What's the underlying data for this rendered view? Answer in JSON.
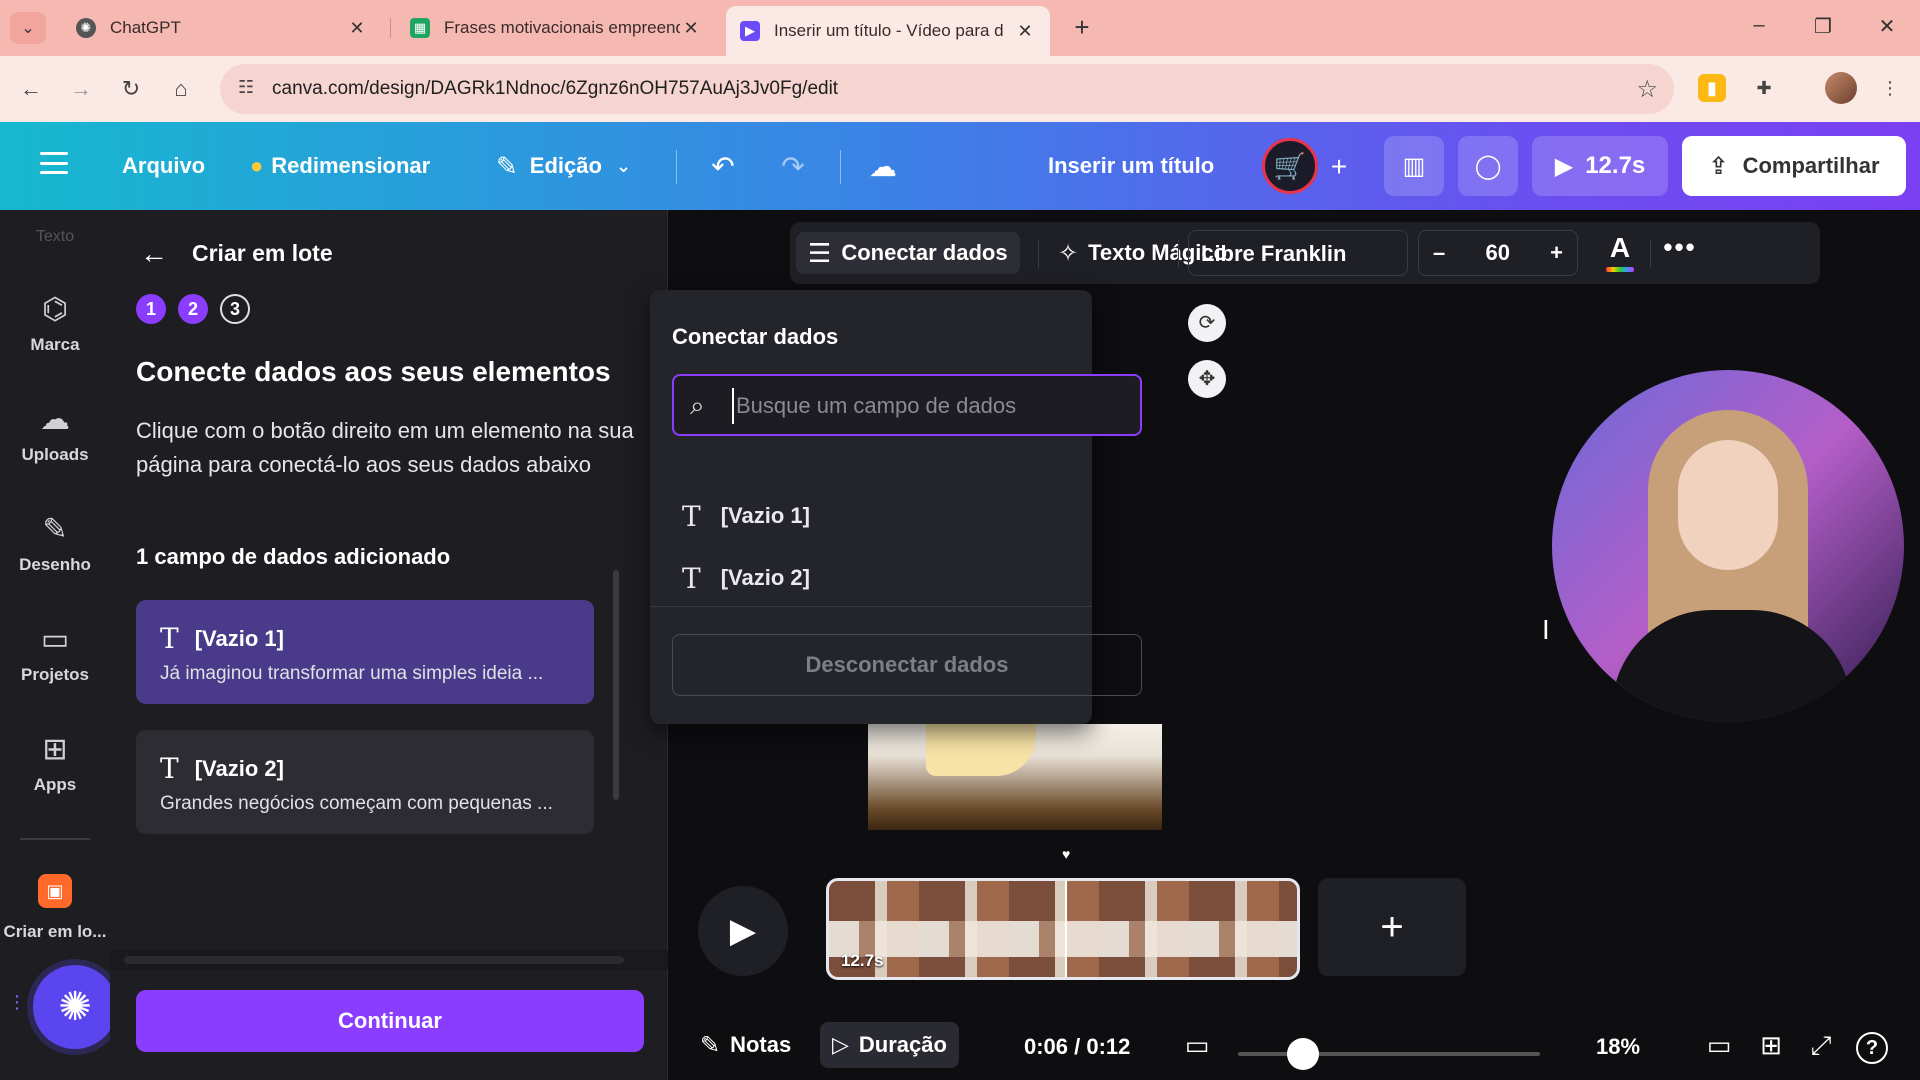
{
  "browser": {
    "tabs": [
      {
        "title": "ChatGPT",
        "favicon": "chatgpt-icon"
      },
      {
        "title": "Frases motivacionais empreend",
        "favicon": "sheets-icon"
      },
      {
        "title": "Inserir um título - Vídeo para d",
        "favicon": "canva-video-icon"
      }
    ],
    "url": "canva.com/design/DAGRk1Ndnoc/6Zgnz6nOH757AuAj3Jv0Fg/edit"
  },
  "header": {
    "file_label": "Arquivo",
    "resize_label": "Redimensionar",
    "edit_label": "Edição",
    "doc_title": "Inserir um título",
    "duration": "12.7s",
    "share_label": "Compartilhar"
  },
  "rail": {
    "top_label": "Texto",
    "items": [
      {
        "label": "Marca",
        "icon": "brand-icon"
      },
      {
        "label": "Uploads",
        "icon": "upload-cloud-icon"
      },
      {
        "label": "Desenho",
        "icon": "draw-icon"
      },
      {
        "label": "Projetos",
        "icon": "folder-icon"
      },
      {
        "label": "Apps",
        "icon": "apps-icon"
      }
    ],
    "bulk_label": "Criar em lo..."
  },
  "panel": {
    "title": "Criar em lote",
    "steps": [
      "1",
      "2",
      "3"
    ],
    "heading": "Conecte dados aos seus elementos",
    "description": "Clique com o botão direito em um elemento na sua página para conectá-lo aos seus dados abaixo",
    "count_label": "1 campo de dados adicionado",
    "fields": [
      {
        "name": "[Vazio 1]",
        "value": "Já imaginou transformar uma simples ideia ..."
      },
      {
        "name": "[Vazio 2]",
        "value": "Grandes negócios começam com pequenas ..."
      }
    ],
    "continue_label": "Continuar"
  },
  "toolbar": {
    "connect_label": "Conectar dados",
    "magic_text_label": "Texto Mágico",
    "font": "Libre Franklin",
    "font_size": "60",
    "minus": "–",
    "plus": "+"
  },
  "dropdown": {
    "title": "Conectar dados",
    "search_placeholder": "Busque um campo de dados",
    "options": [
      "[Vazio 1]",
      "[Vazio 2]"
    ],
    "disconnect_label": "Desconectar dados"
  },
  "timeline": {
    "clip_duration": "12.7s"
  },
  "footer": {
    "notes_label": "Notas",
    "duration_label": "Duração",
    "time": "0:06 / 0:12",
    "zoom": "18%",
    "zoom_fraction": 0.18
  }
}
